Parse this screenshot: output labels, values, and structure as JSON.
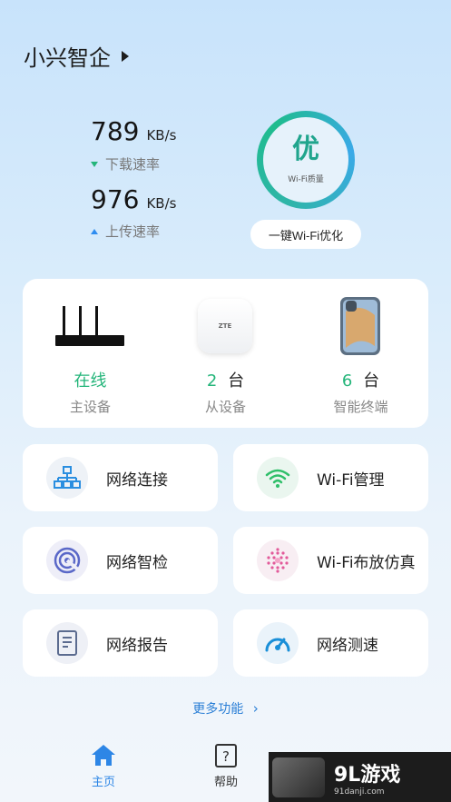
{
  "header": {
    "title": "小兴智企"
  },
  "speed": {
    "download_value": "789",
    "download_unit": "KB/s",
    "download_label": "下载速率",
    "upload_value": "976",
    "upload_unit": "KB/s",
    "upload_label": "上传速率"
  },
  "wifi_quality": {
    "grade": "优",
    "label": "Wi-Fi质量",
    "optimize_label": "一键Wi-Fi优化"
  },
  "devices": {
    "router": {
      "value": "在线",
      "label": "主设备"
    },
    "satellite": {
      "count": "2",
      "unit": "台",
      "label": "从设备",
      "brand": "ZTE"
    },
    "terminals": {
      "count": "6",
      "unit": "台",
      "label": "智能终端"
    }
  },
  "tiles": [
    {
      "label": "网络连接",
      "icon": "network-topology-icon"
    },
    {
      "label": "Wi-Fi管理",
      "icon": "wifi-icon"
    },
    {
      "label": "网络智检",
      "icon": "network-check-icon"
    },
    {
      "label": "Wi-Fi布放仿真",
      "icon": "wifi-heatmap-icon"
    },
    {
      "label": "网络报告",
      "icon": "report-icon"
    },
    {
      "label": "网络测速",
      "icon": "speedometer-icon"
    }
  ],
  "more_label": "更多功能",
  "nav": {
    "home": "主页",
    "help": "帮助"
  },
  "watermark": {
    "brand": "9L游戏",
    "site": "91danji.com"
  },
  "colors": {
    "green": "#24b57a",
    "blue": "#2f8df0",
    "link": "#2b7fd6"
  }
}
